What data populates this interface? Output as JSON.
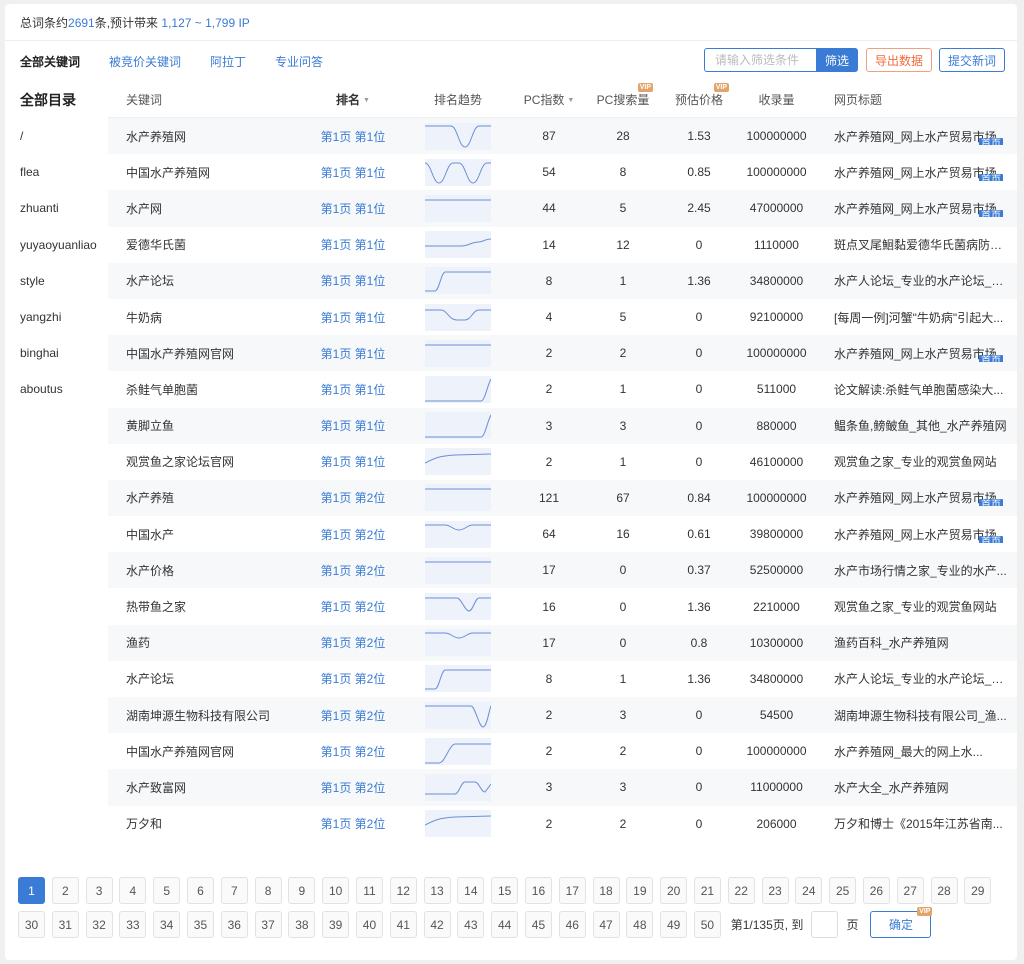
{
  "summary": {
    "prefix": "总词条约",
    "total": "2691",
    "mid": "条,预计带来",
    "range": "1,127 ~ 1,799 IP"
  },
  "tabs": [
    {
      "label": "全部关键词",
      "active": true
    },
    {
      "label": "被竞价关键词",
      "active": false
    },
    {
      "label": "阿拉丁",
      "active": false
    },
    {
      "label": "专业问答",
      "active": false
    }
  ],
  "toolbar": {
    "filter_placeholder": "请输入筛选条件",
    "filter_label": "筛选",
    "export_label": "导出数据",
    "submit_label": "提交新词"
  },
  "sidebar": {
    "title": "全部目录",
    "items": [
      "/",
      "flea",
      "zhuanti",
      "yuyaoyuanliao",
      "style",
      "yangzhi",
      "binghai",
      "aboutus"
    ]
  },
  "table": {
    "headers": {
      "keyword": "关键词",
      "rank": "排名",
      "trend": "排名趋势",
      "pc_index": "PC指数",
      "pc_search": "PC搜索量",
      "price": "预估价格",
      "indexed": "收录量",
      "page_title": "网页标题",
      "vip": "VIP"
    },
    "badge_label": "首页",
    "rows": [
      {
        "keyword": "水产养殖网",
        "rank": "第1页 第1位",
        "trend": "dip",
        "pc_index": "87",
        "pc_search": "28",
        "price": "1.53",
        "indexed": "100000000",
        "title": "水产养殖网_网上水产贸易市场",
        "badge": true
      },
      {
        "keyword": "中国水产养殖网",
        "rank": "第1页 第1位",
        "trend": "double-dip",
        "pc_index": "54",
        "pc_search": "8",
        "price": "0.85",
        "indexed": "100000000",
        "title": "水产养殖网_网上水产贸易市场",
        "badge": true
      },
      {
        "keyword": "水产网",
        "rank": "第1页 第1位",
        "trend": "flat",
        "pc_index": "44",
        "pc_search": "5",
        "price": "2.45",
        "indexed": "47000000",
        "title": "水产养殖网_网上水产贸易市场",
        "badge": true
      },
      {
        "keyword": "爱德华氏菌",
        "rank": "第1页 第1位",
        "trend": "step-up-small",
        "pc_index": "14",
        "pc_search": "12",
        "price": "0",
        "indexed": "1110000",
        "title": "斑点叉尾鮰黏爱德华氏菌病防治...",
        "badge": false
      },
      {
        "keyword": "水产论坛",
        "rank": "第1页 第1位",
        "trend": "rise",
        "pc_index": "8",
        "pc_search": "1",
        "price": "1.36",
        "indexed": "34800000",
        "title": "水产人论坛_专业的水产论坛_水...",
        "badge": false
      },
      {
        "keyword": "牛奶病",
        "rank": "第1页 第1位",
        "trend": "shallow-dip",
        "pc_index": "4",
        "pc_search": "5",
        "price": "0",
        "indexed": "92100000",
        "title": "[每周一例]河蟹\"牛奶病\"引起大...",
        "badge": false
      },
      {
        "keyword": "中国水产养殖网官网",
        "rank": "第1页 第1位",
        "trend": "flat",
        "pc_index": "2",
        "pc_search": "2",
        "price": "0",
        "indexed": "100000000",
        "title": "水产养殖网_网上水产贸易市场",
        "badge": true
      },
      {
        "keyword": "杀鲑气单胞菌",
        "rank": "第1页 第1位",
        "trend": "late-rise",
        "pc_index": "2",
        "pc_search": "1",
        "price": "0",
        "indexed": "511000",
        "title": "论文解读:杀鲑气单胞菌感染大...",
        "badge": false
      },
      {
        "keyword": "黄脚立鱼",
        "rank": "第1页 第1位",
        "trend": "late-rise",
        "pc_index": "3",
        "pc_search": "3",
        "price": "0",
        "indexed": "880000",
        "title": "鳁条鱼,鳑鲏鱼_其他_水产养殖网",
        "badge": false
      },
      {
        "keyword": "观赏鱼之家论坛官网",
        "rank": "第1页 第1位",
        "trend": "gentle-rise",
        "pc_index": "2",
        "pc_search": "1",
        "price": "0",
        "indexed": "46100000",
        "title": "观赏鱼之家_专业的观赏鱼网站",
        "badge": false
      },
      {
        "keyword": "水产养殖",
        "rank": "第1页 第2位",
        "trend": "flat",
        "pc_index": "121",
        "pc_search": "67",
        "price": "0.84",
        "indexed": "100000000",
        "title": "水产养殖网_网上水产贸易市场",
        "badge": true
      },
      {
        "keyword": "中国水产",
        "rank": "第1页 第2位",
        "trend": "wave",
        "pc_index": "64",
        "pc_search": "16",
        "price": "0.61",
        "indexed": "39800000",
        "title": "水产养殖网_网上水产贸易市场",
        "badge": true
      },
      {
        "keyword": "水产价格",
        "rank": "第1页 第2位",
        "trend": "flat",
        "pc_index": "17",
        "pc_search": "0",
        "price": "0.37",
        "indexed": "52500000",
        "title": "水产市场行情之家_专业的水产...",
        "badge": false
      },
      {
        "keyword": "热带鱼之家",
        "rank": "第1页 第2位",
        "trend": "v-dip",
        "pc_index": "16",
        "pc_search": "0",
        "price": "1.36",
        "indexed": "2210000",
        "title": "观赏鱼之家_专业的观赏鱼网站",
        "badge": false
      },
      {
        "keyword": "渔药",
        "rank": "第1页 第2位",
        "trend": "wave",
        "pc_index": "17",
        "pc_search": "0",
        "price": "0.8",
        "indexed": "10300000",
        "title": "渔药百科_水产养殖网",
        "badge": false
      },
      {
        "keyword": "水产论坛",
        "rank": "第1页 第2位",
        "trend": "rise",
        "pc_index": "8",
        "pc_search": "1",
        "price": "1.36",
        "indexed": "34800000",
        "title": "水产人论坛_专业的水产论坛_水...",
        "badge": false
      },
      {
        "keyword": "湖南坤源生物科技有限公司",
        "rank": "第1页 第2位",
        "trend": "deep-v",
        "pc_index": "2",
        "pc_search": "3",
        "price": "0",
        "indexed": "54500",
        "title": "湖南坤源生物科技有限公司_渔...",
        "badge": false
      },
      {
        "keyword": "中国水产养殖网官网",
        "rank": "第1页 第2位",
        "trend": "rise-mid",
        "pc_index": "2",
        "pc_search": "2",
        "price": "0",
        "indexed": "100000000",
        "title": "水产养殖网_最大的网上水...",
        "badge": false
      },
      {
        "keyword": "水产致富网",
        "rank": "第1页 第2位",
        "trend": "bump",
        "pc_index": "3",
        "pc_search": "3",
        "price": "0",
        "indexed": "11000000",
        "title": "水产大全_水产养殖网",
        "badge": false
      },
      {
        "keyword": "万夕和",
        "rank": "第1页 第2位",
        "trend": "gentle-rise",
        "pc_index": "2",
        "pc_search": "2",
        "price": "0",
        "indexed": "206000",
        "title": "万夕和博士《2015年江苏省南...",
        "badge": false
      }
    ]
  },
  "pager": {
    "pages_row1": [
      "1",
      "2",
      "3",
      "4",
      "5",
      "6",
      "7",
      "8",
      "9",
      "10",
      "11",
      "12",
      "13",
      "14",
      "15",
      "16",
      "17",
      "18",
      "19",
      "20",
      "21",
      "22",
      "23",
      "24",
      "25",
      "26",
      "27",
      "28",
      "29"
    ],
    "pages_row2": [
      "30",
      "31",
      "32",
      "33",
      "34",
      "35",
      "36",
      "37",
      "38",
      "39",
      "40",
      "41",
      "42",
      "43",
      "44",
      "45",
      "46",
      "47",
      "48",
      "49",
      "50"
    ],
    "current": "1",
    "info": "第1/135页, 到",
    "unit": "页",
    "confirm_label": "确定"
  },
  "colors": {
    "accent": "#3a7bd5",
    "export": "#f16b3b",
    "vip": "#e2a46b"
  }
}
